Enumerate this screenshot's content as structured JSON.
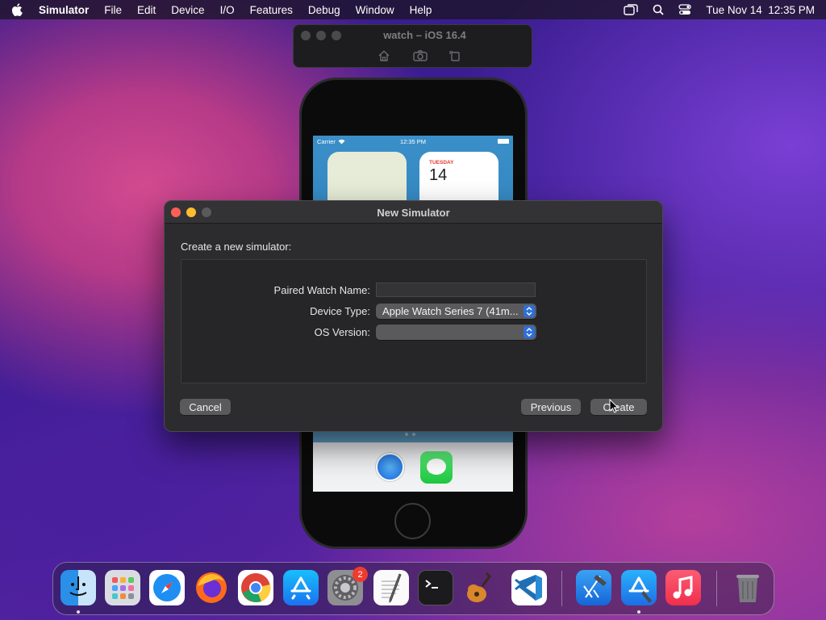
{
  "menubar": {
    "app_name": "Simulator",
    "items": [
      "File",
      "Edit",
      "Device",
      "I/O",
      "Features",
      "Debug",
      "Window",
      "Help"
    ],
    "datetime": "Tue Nov 14  12:35 PM"
  },
  "sim_window": {
    "title": "watch – iOS 16.4"
  },
  "phone": {
    "carrier": "Carrier",
    "time": "12:35 PM",
    "calendar_day": "TUESDAY",
    "calendar_date": "14"
  },
  "dialog": {
    "title": "New Simulator",
    "subtitle": "Create a new simulator:",
    "fields": {
      "paired_watch_name_label": "Paired Watch Name:",
      "paired_watch_name_value": "",
      "device_type_label": "Device Type:",
      "device_type_value": "Apple Watch Series 7 (41m...",
      "os_version_label": "OS Version:",
      "os_version_value": ""
    },
    "buttons": {
      "cancel": "Cancel",
      "previous": "Previous",
      "create": "Create"
    }
  },
  "dock": {
    "apps": [
      "Finder",
      "Launchpad",
      "Safari",
      "Firefox",
      "Chrome",
      "App Store",
      "System Settings",
      "TextEdit",
      "Terminal",
      "GarageBand",
      "Visual Studio Code",
      "Xcode",
      "Simulator",
      "Music",
      "Trash"
    ],
    "system_settings_badge": "2"
  },
  "colors": {
    "accent": "#2e6fd9",
    "dialog_bg": "#2c2c2e",
    "close": "#fe5f57",
    "minimize": "#febc2e"
  }
}
